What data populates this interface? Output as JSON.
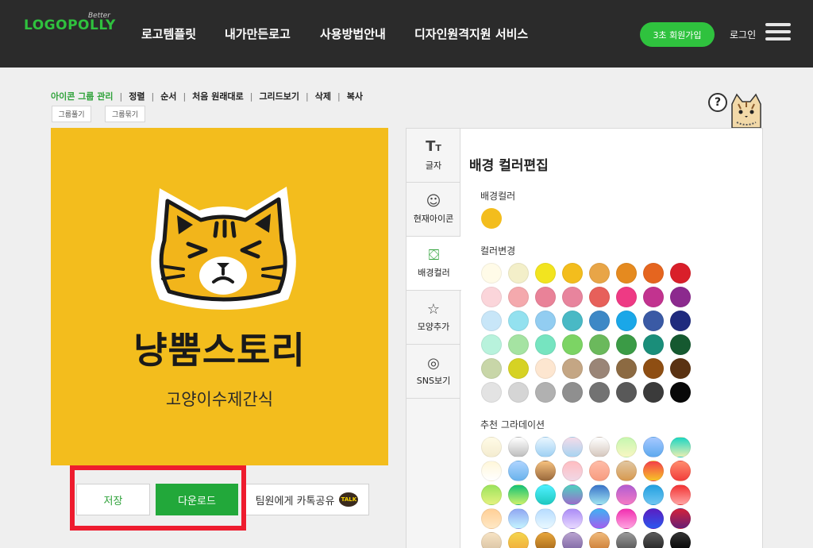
{
  "header": {
    "logo_better": "Better",
    "logo": "LOGOPOLLY",
    "nav": [
      "로고템플릿",
      "내가만든로고",
      "사용방법안내",
      "디자인원격지원 서비스"
    ],
    "signup": "3초 회원가입",
    "login": "로그인"
  },
  "toolbar": {
    "items": [
      "아이콘 그룹 관리",
      "정렬",
      "순서",
      "처음 원래대로",
      "그리드보기",
      "삭제",
      "복사"
    ],
    "group_expand": "그룹풀기",
    "group_bind": "그룹묶기"
  },
  "help": {
    "symbol": "?"
  },
  "canvas": {
    "background_color": "#f3bd1d",
    "title": "냥뿜스토리",
    "subtitle": "고양이수제간식"
  },
  "actions": {
    "save": "저장",
    "download": "다운로드",
    "share": "팀원에게 카톡공유",
    "talk_badge": "TALK"
  },
  "panel": {
    "tabs": [
      {
        "label": "글자",
        "icon": "text-icon"
      },
      {
        "label": "현재아이콘",
        "icon": "smiley-icon"
      },
      {
        "label": "배경컬러",
        "icon": "paint-bucket-icon"
      },
      {
        "label": "모양추가",
        "icon": "star-icon"
      },
      {
        "label": "SNS보기",
        "icon": "user-icon"
      }
    ],
    "active_tab": "배경컬러",
    "title": "배경 컬러편집",
    "bg_color_label": "배경컬러",
    "current_color": "#f3bd1d",
    "change_color_label": "컬러변경",
    "colors": [
      "#fffbe8",
      "#f3efc9",
      "#f2e41f",
      "#f3bd1d",
      "#e8a547",
      "#e58a1f",
      "#e5651f",
      "#d91f2a",
      "#fbd5da",
      "#f4a9ad",
      "#e98298",
      "#e8849d",
      "#e7605a",
      "#ee3a84",
      "#c2338f",
      "#8c2a8e",
      "#c8e6f8",
      "#93e1ef",
      "#92cdf1",
      "#49b9c5",
      "#3d88c6",
      "#1aa7e8",
      "#3a5aa5",
      "#1f2b7e",
      "#b8f2dc",
      "#a5e3a2",
      "#76e4c0",
      "#7cd464",
      "#6bb95c",
      "#3b9b46",
      "#1a8e7a",
      "#155930",
      "#c8d6a8",
      "#d6d224",
      "#fde6d0",
      "#c4a684",
      "#9a8577",
      "#8c6a42",
      "#8e4e13",
      "#5a3212",
      "#e3e3e3",
      "#d5d5d5",
      "#b1b1b1",
      "#8f8f8f",
      "#727272",
      "#595959",
      "#3b3b3b",
      "#080808"
    ],
    "gradient_label": "추천 그라데이션",
    "gradients": [
      [
        "#fffbe6",
        "#f4ecd0"
      ],
      [
        "#ffffff",
        "#bdbdbd"
      ],
      [
        "#e8f6ff",
        "#9ed0f3"
      ],
      [
        "#f3dbe9",
        "#a8d4f1"
      ],
      [
        "#ffffff",
        "#d5c7bd"
      ],
      [
        "#c6f7b0",
        "#f7f7c2"
      ],
      [
        "#a5c8ff",
        "#5ea9ef"
      ],
      [
        "#1fd6c2",
        "#e6efb3"
      ],
      [
        "#fff7da",
        "#ffffff"
      ],
      [
        "#aed4ff",
        "#6ab3ec"
      ],
      [
        "#f5c07e",
        "#9b6a3c"
      ],
      [
        "#ffbdc1",
        "#f1d7e5"
      ],
      [
        "#ffbca7",
        "#f79c80"
      ],
      [
        "#e1c7a1",
        "#d79950"
      ],
      [
        "#f4404a",
        "#f7c328"
      ],
      [
        "#ff8b6d",
        "#f23f3c"
      ],
      [
        "#9be35d",
        "#e4f27e"
      ],
      [
        "#15c276",
        "#cbf26a"
      ],
      [
        "#4ff0ff",
        "#1ec9c0"
      ],
      [
        "#4fd0c0",
        "#9a6fcb"
      ],
      [
        "#3a73c9",
        "#9fe3f1"
      ],
      [
        "#b15dd2",
        "#f57ac4"
      ],
      [
        "#24a0e0",
        "#6ec6f2"
      ],
      [
        "#f23333",
        "#ffa3a3"
      ],
      [
        "#ffcf96",
        "#ffe8c5"
      ],
      [
        "#90a7f2",
        "#c4f3ff"
      ],
      [
        "#b7dcff",
        "#e8f8ff"
      ],
      [
        "#ab8cf6",
        "#e7d8ff"
      ],
      [
        "#41b0f2",
        "#a15ff0"
      ],
      [
        "#f12fb0",
        "#ffa3e0"
      ],
      [
        "#5a1ec2",
        "#2d56ee"
      ],
      [
        "#d2213b",
        "#691e74"
      ],
      [
        "#f7e3c4",
        "#d7c1a1"
      ],
      [
        "#f5d54d",
        "#f0a93a"
      ],
      [
        "#e7a53b",
        "#a36618"
      ],
      [
        "#b8a2d0",
        "#7a62a0"
      ],
      [
        "#f0b97a",
        "#c9782f"
      ],
      [
        "#999999",
        "#4f4f4f"
      ],
      [
        "#5c5c5c",
        "#1e1e1e"
      ],
      [
        "#333333",
        "#000000"
      ]
    ]
  }
}
